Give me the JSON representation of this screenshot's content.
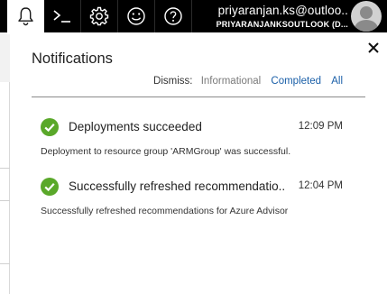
{
  "topbar": {
    "icons": [
      "bell-icon",
      "cloud-shell-icon",
      "gear-icon",
      "smiley-icon",
      "help-icon"
    ],
    "account_name": "priyaranjan.ks@outloo..",
    "account_directory": "PRIYARANJANKSOUTLOOK (D..."
  },
  "panel": {
    "title": "Notifications",
    "dismiss_label": "Dismiss:",
    "dismiss_informational": "Informational",
    "dismiss_completed": "Completed",
    "dismiss_all": "All",
    "close_icon": "close-icon"
  },
  "notifications": [
    {
      "icon": "check-circle-icon",
      "title": "Deployments succeeded",
      "time": "12:09 PM",
      "description": "Deployment to resource group 'ARMGroup' was successful."
    },
    {
      "icon": "check-circle-icon",
      "title": "Successfully refreshed recommendatio..",
      "time": "12:04 PM",
      "description": "Successfully refreshed recommendations for Azure Advisor"
    }
  ],
  "colors": {
    "topbar_bg": "#000000",
    "success_green": "#5aa82a",
    "link_blue": "#1a5fa8"
  }
}
